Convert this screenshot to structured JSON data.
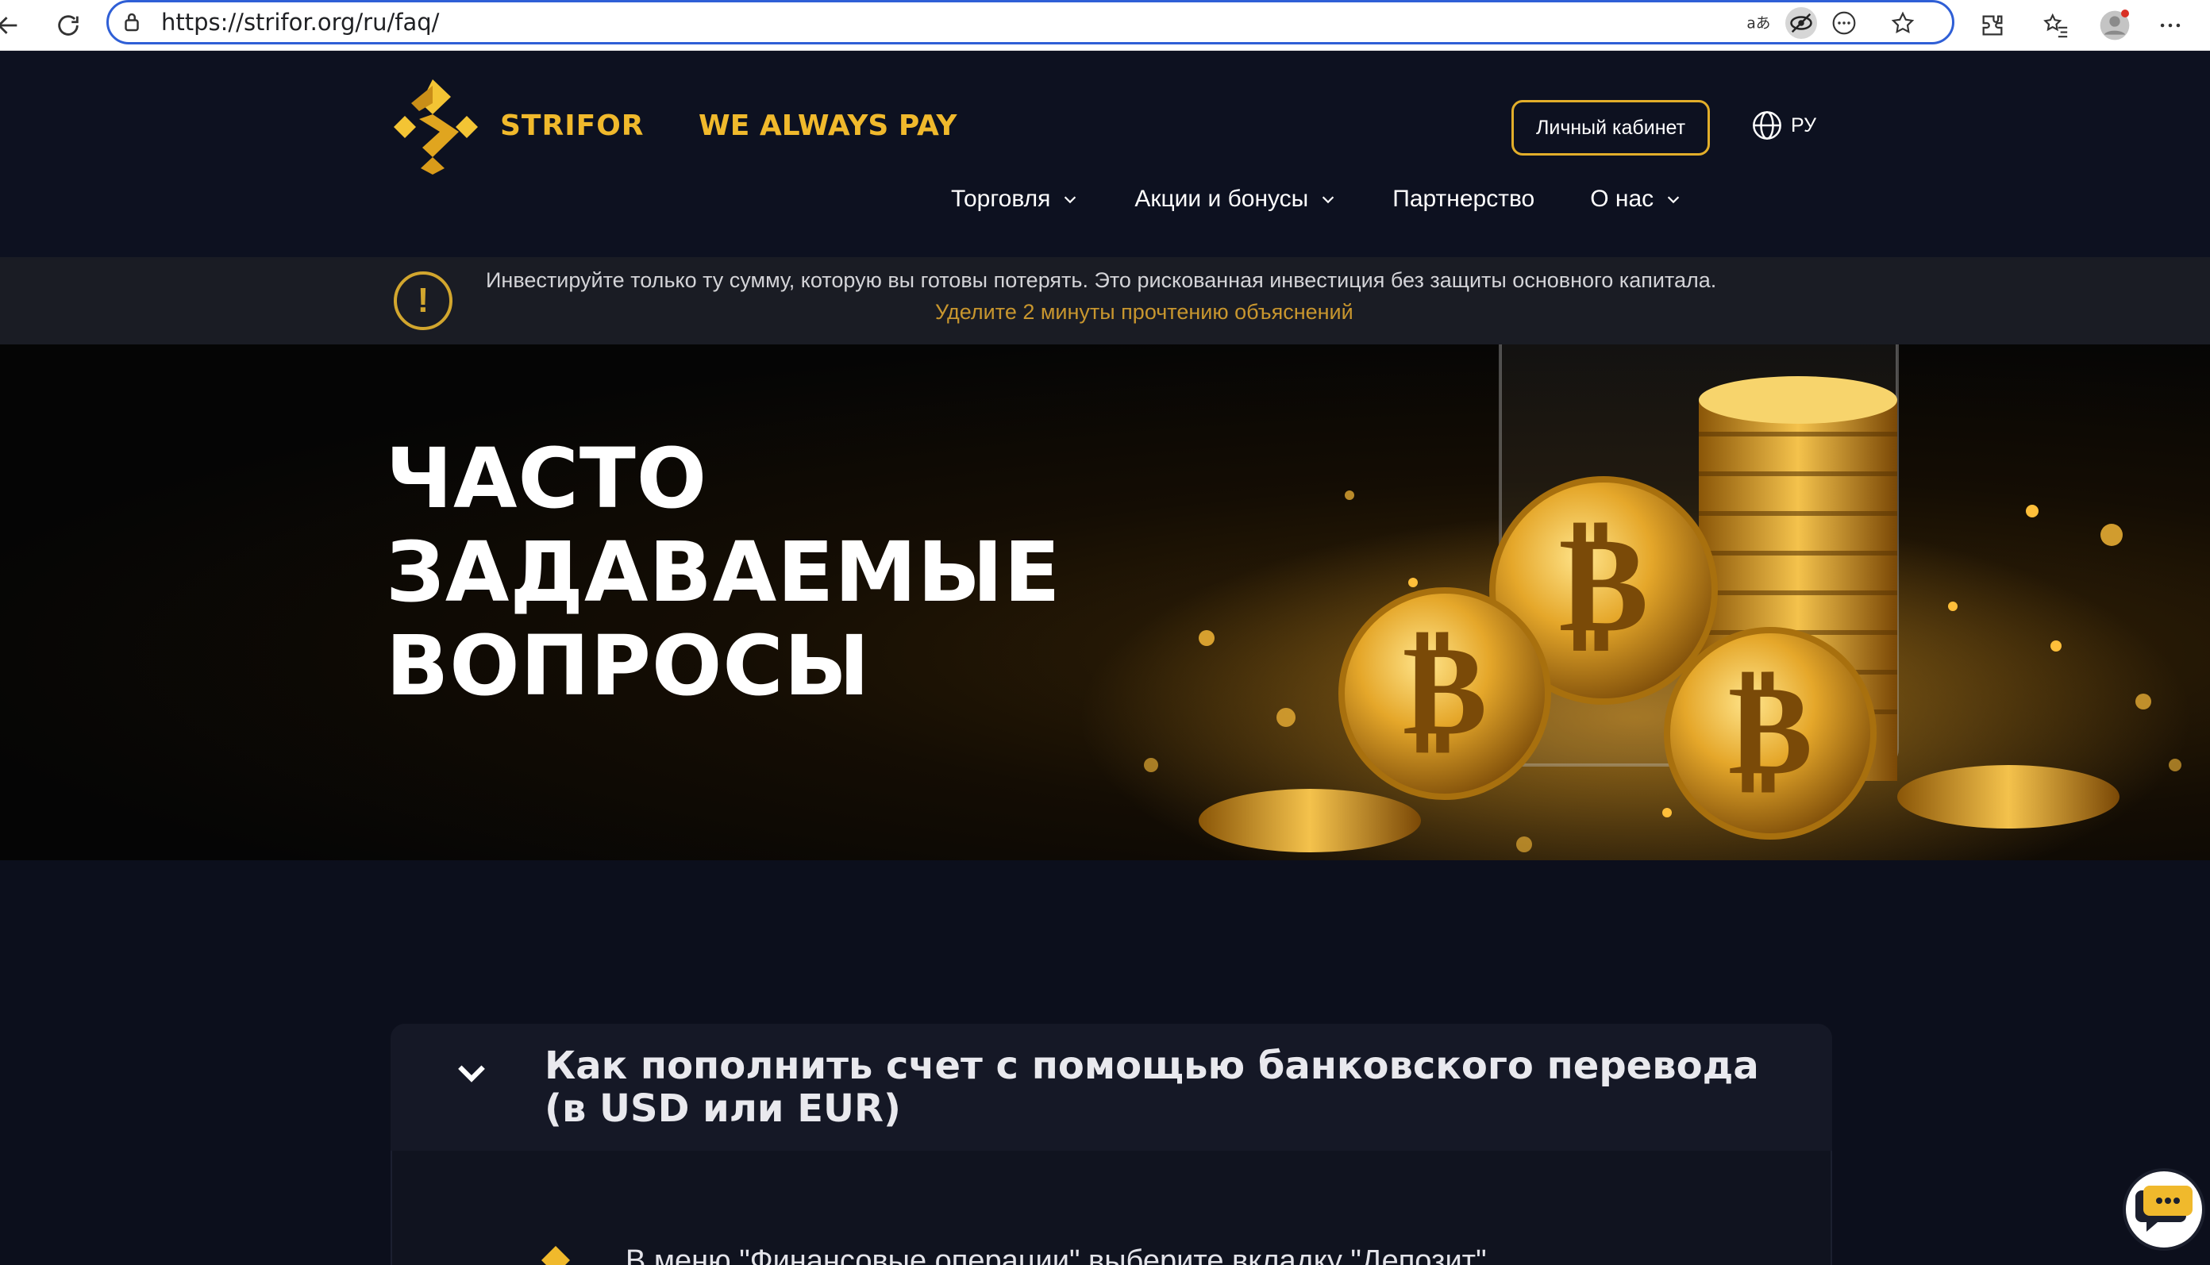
{
  "browser": {
    "url": "https://strifor.org/ru/faq/",
    "icons": [
      "back-icon",
      "reload-icon",
      "lock-icon",
      "translate-icon",
      "tracking-prevention-icon",
      "more-options-icon",
      "favorite-star-icon",
      "extensions-icon",
      "favorites-list-icon",
      "profile-avatar-icon",
      "menu-dots-icon"
    ]
  },
  "header": {
    "brand": "STRIFOR",
    "slogan": "WE ALWAYS PAY",
    "cabinet_button": "Личный кабинет",
    "language": "РУ",
    "nav": [
      {
        "label": "Торговля",
        "has_dropdown": true
      },
      {
        "label": "Акции и бонусы",
        "has_dropdown": true
      },
      {
        "label": "Партнерство",
        "has_dropdown": false
      },
      {
        "label": "О нас",
        "has_dropdown": true
      }
    ]
  },
  "warning": {
    "text": "Инвестируйте только ту сумму, которую вы готовы потерять. Это рискованная инвестиция без защиты основного капитала.",
    "link": "Уделите 2 минуты прочтению объяснений"
  },
  "hero": {
    "title_lines": [
      "ЧАСТО",
      "ЗАДАВАЕМЫЕ",
      "ВОПРОСЫ"
    ]
  },
  "faq": {
    "items": [
      {
        "question": "Как пополнить счет с помощью банковского перевода (в USD или EUR)",
        "expanded": true,
        "first_step": "В меню \"Финансовые операции\" выберите вкладку \"Депозит\""
      }
    ]
  },
  "colors": {
    "accent_gold": "#f0b92c",
    "background": "#0c0f1c",
    "browser_focus": "#2f5fd6"
  }
}
